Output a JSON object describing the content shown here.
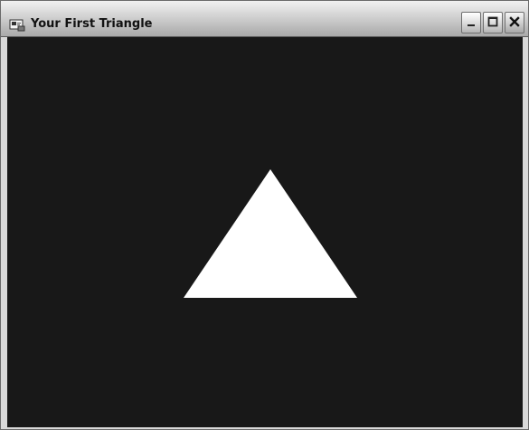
{
  "window": {
    "title": "Your First Triangle",
    "app_icon": "application-icon",
    "controls": [
      {
        "name": "minimize-button",
        "icon": "minimize-icon"
      },
      {
        "name": "maximize-button",
        "icon": "maximize-icon"
      },
      {
        "name": "close-button",
        "icon": "close-icon"
      }
    ]
  },
  "scene": {
    "background_color": "#181818",
    "shape": "triangle",
    "shape_color": "#ffffff"
  }
}
